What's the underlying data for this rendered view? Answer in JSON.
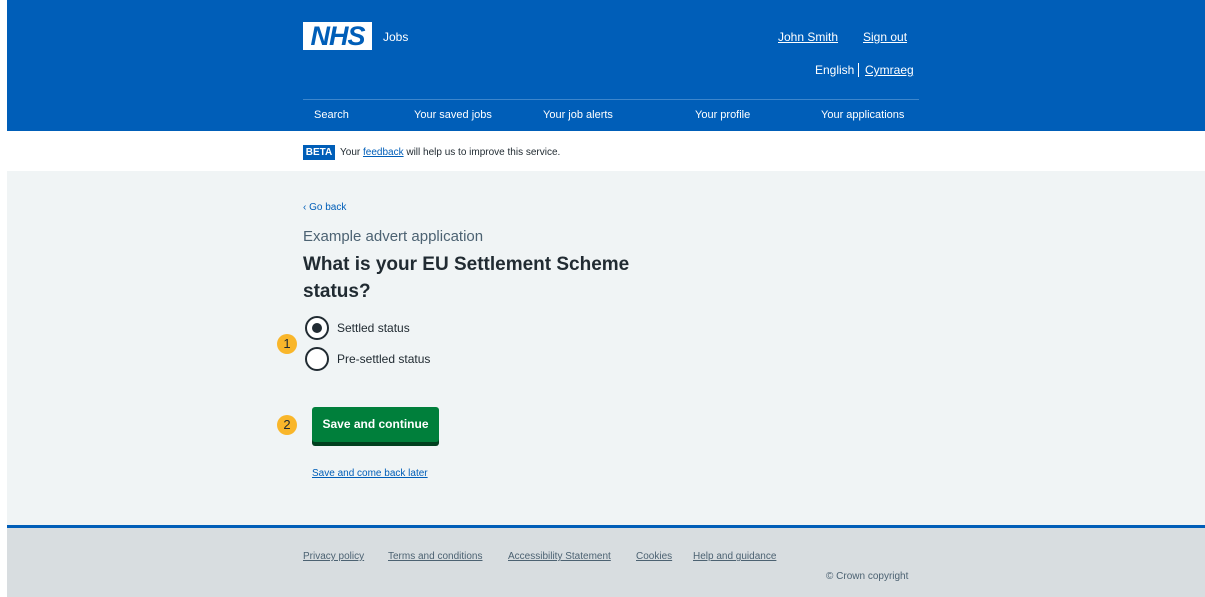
{
  "header": {
    "logo_text": "NHS",
    "service_name": "Jobs",
    "user_name": "John Smith",
    "sign_out": "Sign out",
    "lang_english": "English",
    "lang_welsh": "Cymraeg",
    "nav": [
      "Search",
      "Your saved jobs",
      "Your job alerts",
      "Your profile",
      "Your applications"
    ],
    "brand_color": "#005eb8"
  },
  "beta": {
    "tag": "BETA",
    "text_before": "Your ",
    "link": "feedback",
    "text_after": " will help us to improve this service."
  },
  "main": {
    "back_link": "Go back",
    "caption": "Example advert application",
    "heading": "What is your EU Settlement Scheme status?",
    "options": [
      {
        "label": "Settled status",
        "checked": true
      },
      {
        "label": "Pre-settled status",
        "checked": false
      }
    ],
    "markers": [
      "1",
      "2"
    ],
    "save_button": "Save and continue",
    "save_later": "Save and come back later",
    "button_color": "#007f3b",
    "marker_color": "#f9b62a"
  },
  "footer": {
    "links": [
      "Privacy policy",
      "Terms and conditions",
      "Accessibility Statement",
      "Cookies",
      "Help and guidance"
    ],
    "copyright": "© Crown copyright"
  }
}
